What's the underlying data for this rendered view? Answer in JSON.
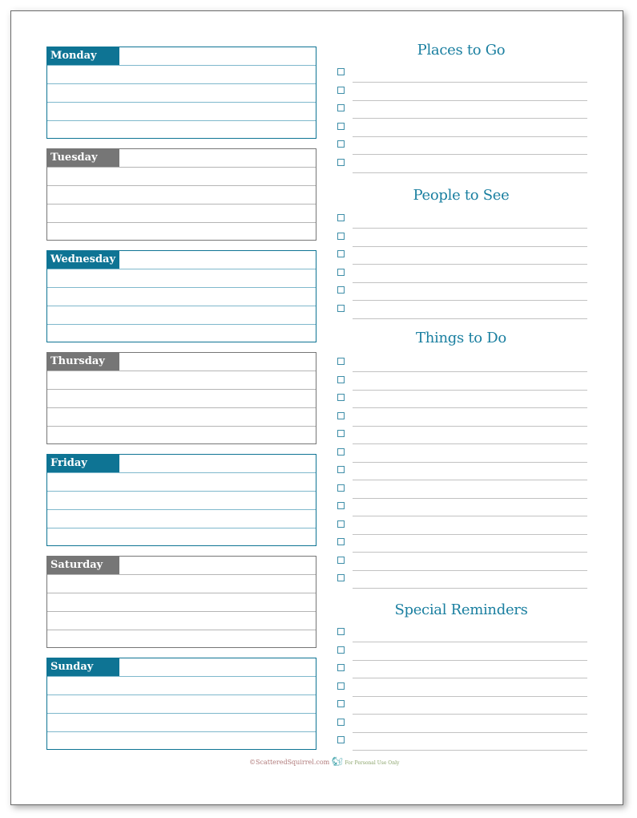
{
  "colors": {
    "accent": "#0e7494",
    "accent_rule": "#7fb8cc",
    "gray": "#767676",
    "gray_rule": "#b5b5b5",
    "heading": "#1a7fa0",
    "checkbox": "#3e8ea8",
    "list_rule": "#c2c2c2"
  },
  "days": [
    {
      "label": "Monday",
      "style": "accent"
    },
    {
      "label": "Tuesday",
      "style": "gray"
    },
    {
      "label": "Wednesday",
      "style": "accent"
    },
    {
      "label": "Thursday",
      "style": "gray"
    },
    {
      "label": "Friday",
      "style": "accent"
    },
    {
      "label": "Saturday",
      "style": "gray"
    },
    {
      "label": "Sunday",
      "style": "accent"
    }
  ],
  "sections": [
    {
      "title": "Places to Go",
      "item_count": 6
    },
    {
      "title": "People to See",
      "item_count": 6
    },
    {
      "title": "Things to Do",
      "item_count": 13
    },
    {
      "title": "Special Reminders",
      "item_count": 7
    }
  ],
  "footer": {
    "copyright": "©ScatteredSquirrel.com",
    "squirrel_icon": "squirrel-icon",
    "note": "For Personal Use Only"
  }
}
